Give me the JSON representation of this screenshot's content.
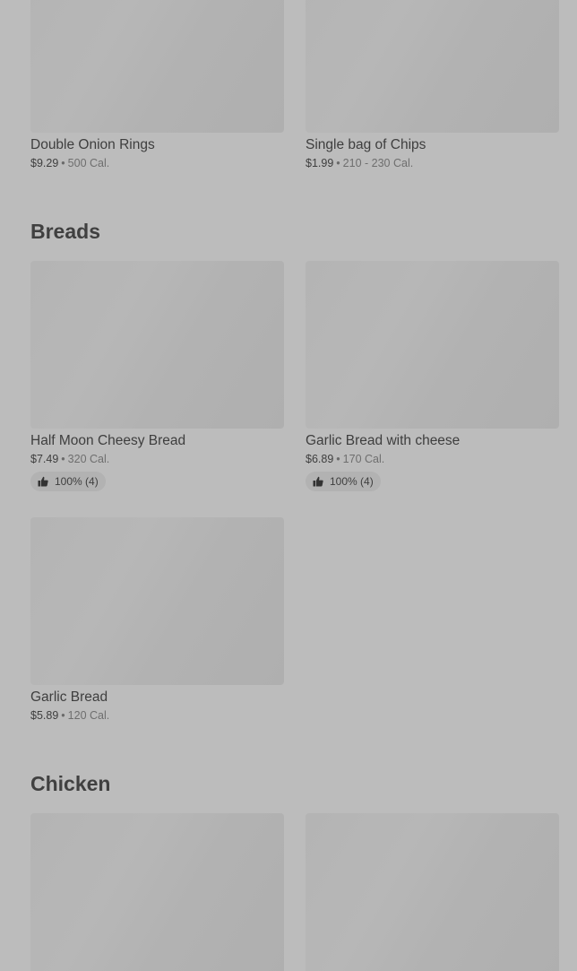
{
  "sections": {
    "top": {
      "items": [
        {
          "name": "Double Onion Rings",
          "price": "$9.29",
          "dot": "•",
          "calories": "500 Cal."
        },
        {
          "name": "Single bag of Chips",
          "price": "$1.99",
          "dot": "•",
          "calories": "210 - 230 Cal."
        }
      ]
    },
    "breads": {
      "title": "Breads",
      "items": [
        {
          "name": "Half Moon Cheesy Bread",
          "price": "$7.49",
          "dot": "•",
          "calories": "320 Cal.",
          "rating": "100% (4)"
        },
        {
          "name": "Garlic Bread with cheese",
          "price": "$6.89",
          "dot": "•",
          "calories": "170 Cal.",
          "rating": "100% (4)"
        },
        {
          "name": "Garlic Bread",
          "price": "$5.89",
          "dot": "•",
          "calories": "120 Cal."
        }
      ]
    },
    "chicken": {
      "title": "Chicken"
    }
  },
  "colors": {
    "background": "#bcbcbc",
    "placeholder": "#b4b4b4",
    "text": "#3e3e3e",
    "muted": "#6e6e6e"
  },
  "icons": {
    "rating": "thumbs-up-icon"
  }
}
